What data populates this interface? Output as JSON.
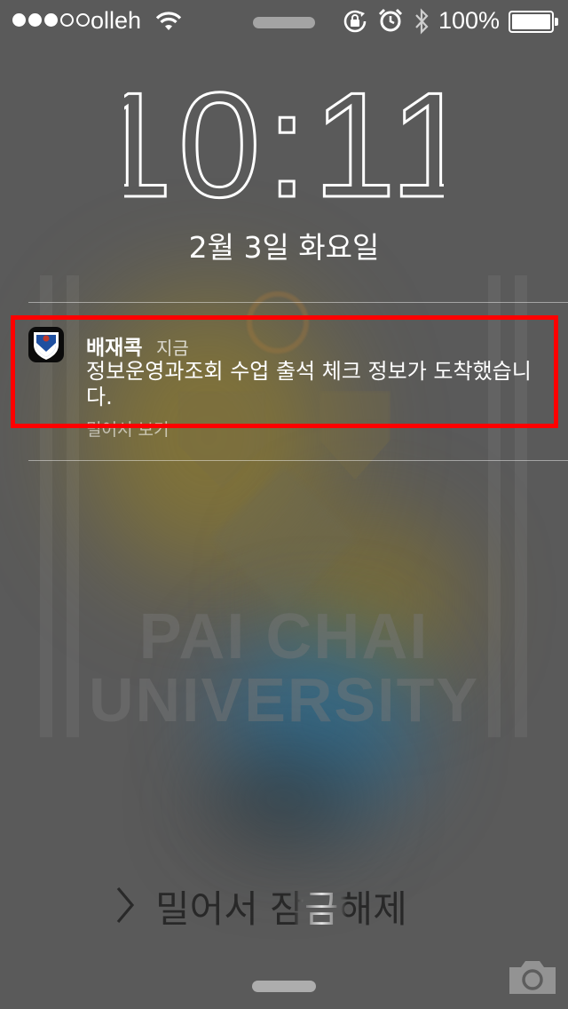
{
  "status_bar": {
    "signal_icon": "signal-dots-icon",
    "carrier": "olleh",
    "wifi_icon": "wifi-icon",
    "rotation_lock_icon": "rotation-lock-icon",
    "alarm_icon": "alarm-clock-icon",
    "bluetooth_icon": "bluetooth-icon",
    "battery_percent": "100%",
    "battery_level": 1.0
  },
  "lock_screen": {
    "time": "10:11",
    "date": "2월 3일 화요일"
  },
  "notification": {
    "app_icon": "university-shield-icon",
    "app_name": "배재콕",
    "time": "지금",
    "message": "정보운영과조회 수업 출석 체크 정보가 도착했습니다.",
    "action": "밀어서 보기",
    "highlight_color": "#ff0000"
  },
  "unlock": {
    "chevron_icon": "chevron-right-icon",
    "label": "밀어서 잠금해제",
    "camera_icon": "camera-icon"
  },
  "wallpaper": {
    "line1": "PAI CHAI",
    "line2": "UNIVERSITY"
  }
}
